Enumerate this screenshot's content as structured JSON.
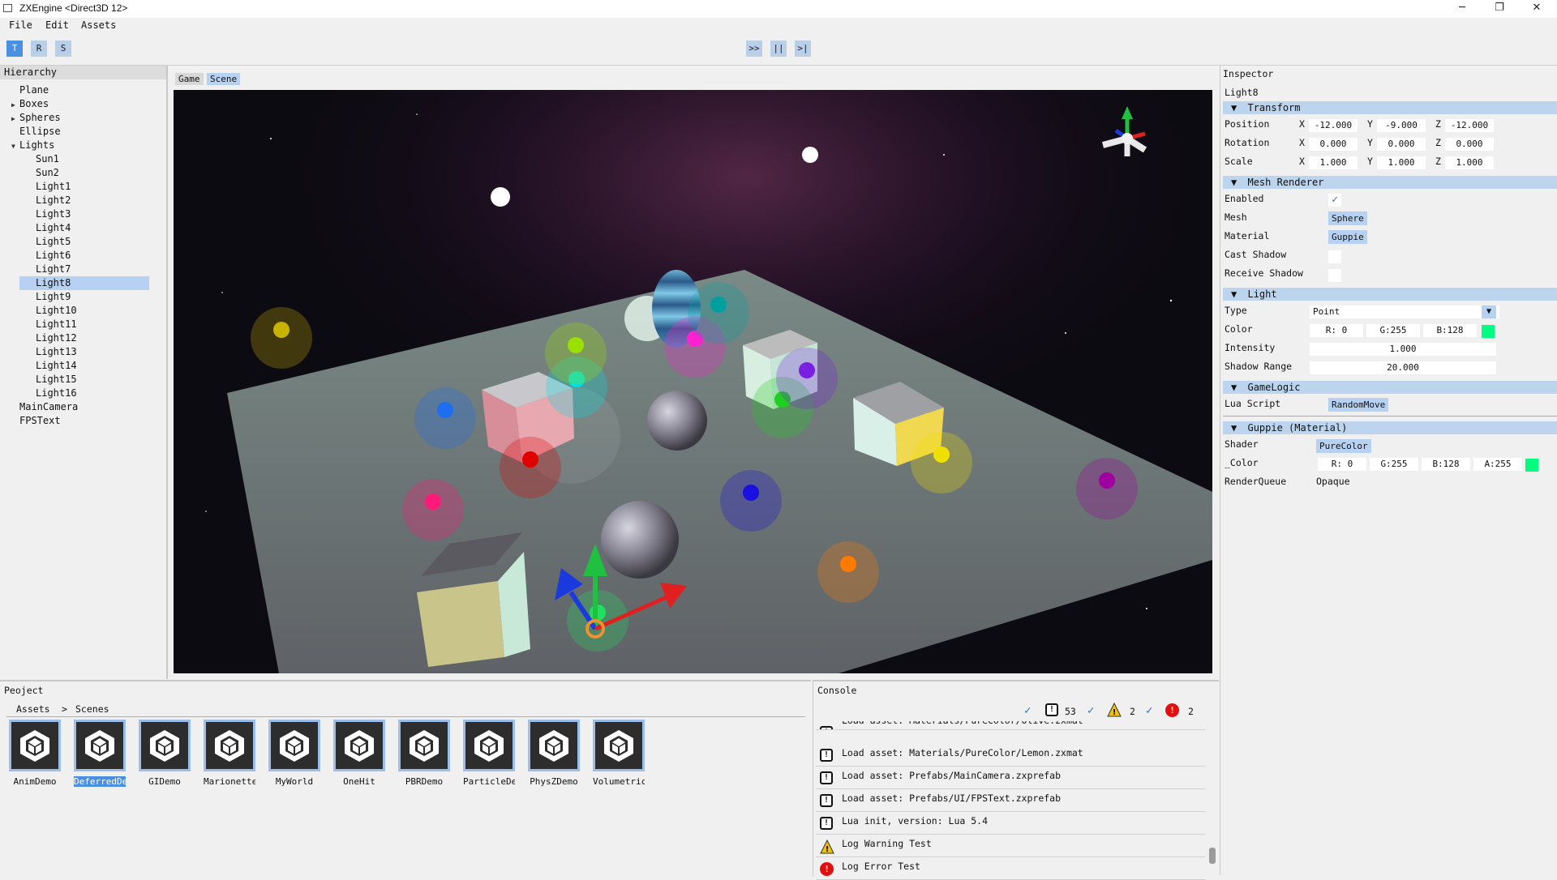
{
  "window": {
    "title": "ZXEngine <Direct3D 12>",
    "minimize": "─",
    "maximize": "❐",
    "close": "✕"
  },
  "menu": [
    "File",
    "Edit",
    "Assets"
  ],
  "toolbar": {
    "transform_buttons": [
      "T",
      "R",
      "S"
    ],
    "play_buttons": [
      ">>",
      "||",
      ">|"
    ]
  },
  "hierarchy": {
    "title": "Hierarchy",
    "items": [
      {
        "label": "Plane",
        "depth": 0,
        "arrow": ""
      },
      {
        "label": "Boxes",
        "depth": 0,
        "arrow": "▶"
      },
      {
        "label": "Spheres",
        "depth": 0,
        "arrow": "▶"
      },
      {
        "label": "Ellipse",
        "depth": 0,
        "arrow": ""
      },
      {
        "label": "Lights",
        "depth": 0,
        "arrow": "▼"
      },
      {
        "label": "Sun1",
        "depth": 1,
        "arrow": ""
      },
      {
        "label": "Sun2",
        "depth": 1,
        "arrow": ""
      },
      {
        "label": "Light1",
        "depth": 1,
        "arrow": ""
      },
      {
        "label": "Light2",
        "depth": 1,
        "arrow": ""
      },
      {
        "label": "Light3",
        "depth": 1,
        "arrow": ""
      },
      {
        "label": "Light4",
        "depth": 1,
        "arrow": ""
      },
      {
        "label": "Light5",
        "depth": 1,
        "arrow": ""
      },
      {
        "label": "Light6",
        "depth": 1,
        "arrow": ""
      },
      {
        "label": "Light7",
        "depth": 1,
        "arrow": ""
      },
      {
        "label": "Light8",
        "depth": 1,
        "arrow": "",
        "selected": true
      },
      {
        "label": "Light9",
        "depth": 1,
        "arrow": ""
      },
      {
        "label": "Light10",
        "depth": 1,
        "arrow": ""
      },
      {
        "label": "Light11",
        "depth": 1,
        "arrow": ""
      },
      {
        "label": "Light12",
        "depth": 1,
        "arrow": ""
      },
      {
        "label": "Light13",
        "depth": 1,
        "arrow": ""
      },
      {
        "label": "Light14",
        "depth": 1,
        "arrow": ""
      },
      {
        "label": "Light15",
        "depth": 1,
        "arrow": ""
      },
      {
        "label": "Light16",
        "depth": 1,
        "arrow": ""
      },
      {
        "label": "MainCamera",
        "depth": 0,
        "arrow": ""
      },
      {
        "label": "FPSText",
        "depth": 0,
        "arrow": ""
      }
    ]
  },
  "viewport": {
    "tabs": [
      "Game",
      "Scene"
    ],
    "active_tab": "Scene"
  },
  "inspector": {
    "title": "Inspector",
    "object_name": "Light8",
    "transform": {
      "header": "Transform",
      "rows": [
        {
          "label": "Position",
          "x": "-12.000",
          "y": "-9.000",
          "z": "-12.000"
        },
        {
          "label": "Rotation",
          "x": "0.000",
          "y": "0.000",
          "z": "0.000"
        },
        {
          "label": "Scale",
          "x": "1.000",
          "y": "1.000",
          "z": "1.000"
        }
      ],
      "axis": [
        "X",
        "Y",
        "Z"
      ]
    },
    "mesh_renderer": {
      "header": "Mesh Renderer",
      "enabled_label": "Enabled",
      "mesh_label": "Mesh",
      "mesh_value": "Sphere",
      "material_label": "Material",
      "material_value": "Guppie",
      "cast_shadow_label": "Cast Shadow",
      "receive_shadow_label": "Receive Shadow"
    },
    "light": {
      "header": "Light",
      "type_label": "Type",
      "type_value": "Point",
      "color_label": "Color",
      "r": "R:  0",
      "g": "G:255",
      "b": "B:128",
      "swatch": "#00ff80",
      "intensity_label": "Intensity",
      "intensity_value": "1.000",
      "shadow_range_label": "Shadow Range",
      "shadow_range_value": "20.000"
    },
    "gamelogic": {
      "header": "GameLogic",
      "lua_label": "Lua Script",
      "lua_value": "RandomMove"
    },
    "material": {
      "header": "Guppie (Material)",
      "shader_label": "Shader",
      "shader_value": "PureColor",
      "color_label": "_Color",
      "r": "R:  0",
      "g": "G:255",
      "b": "B:128",
      "a": "A:255",
      "swatch": "#00ff80",
      "queue_label": "RenderQueue",
      "queue_value": "Opaque"
    }
  },
  "project": {
    "title": "Peoject",
    "breadcrumb": [
      "Assets",
      ">",
      "Scenes"
    ],
    "assets": [
      "AnimDemo",
      "DeferredDe",
      "GIDemo",
      "Marionette",
      "MyWorld",
      "OneHit",
      "PBRDemo",
      "ParticleDe",
      "PhysZDemo",
      "Volumetric"
    ],
    "selected_asset": "DeferredDe"
  },
  "console": {
    "title": "Console",
    "counts": {
      "info": "53",
      "warning": "2",
      "error": "2"
    },
    "logs": [
      {
        "type": "info",
        "text": "Load asset: Materials/PureColor/Olive.zxmat"
      },
      {
        "type": "info",
        "text": "Load asset: Materials/PureColor/Lemon.zxmat"
      },
      {
        "type": "info",
        "text": "Load asset: Prefabs/MainCamera.zxprefab"
      },
      {
        "type": "info",
        "text": "Load asset: Prefabs/UI/FPSText.zxprefab"
      },
      {
        "type": "info",
        "text": "Lua init, version: Lua 5.4"
      },
      {
        "type": "warning",
        "text": "Log Warning Test"
      },
      {
        "type": "error",
        "text": "Log Error Test"
      }
    ]
  },
  "colors": {
    "accent": "#4a90e2",
    "selection": "#b6d1f2",
    "section_header": "#bcd4ee",
    "warning": "#f2c200",
    "error": "#e01010"
  }
}
